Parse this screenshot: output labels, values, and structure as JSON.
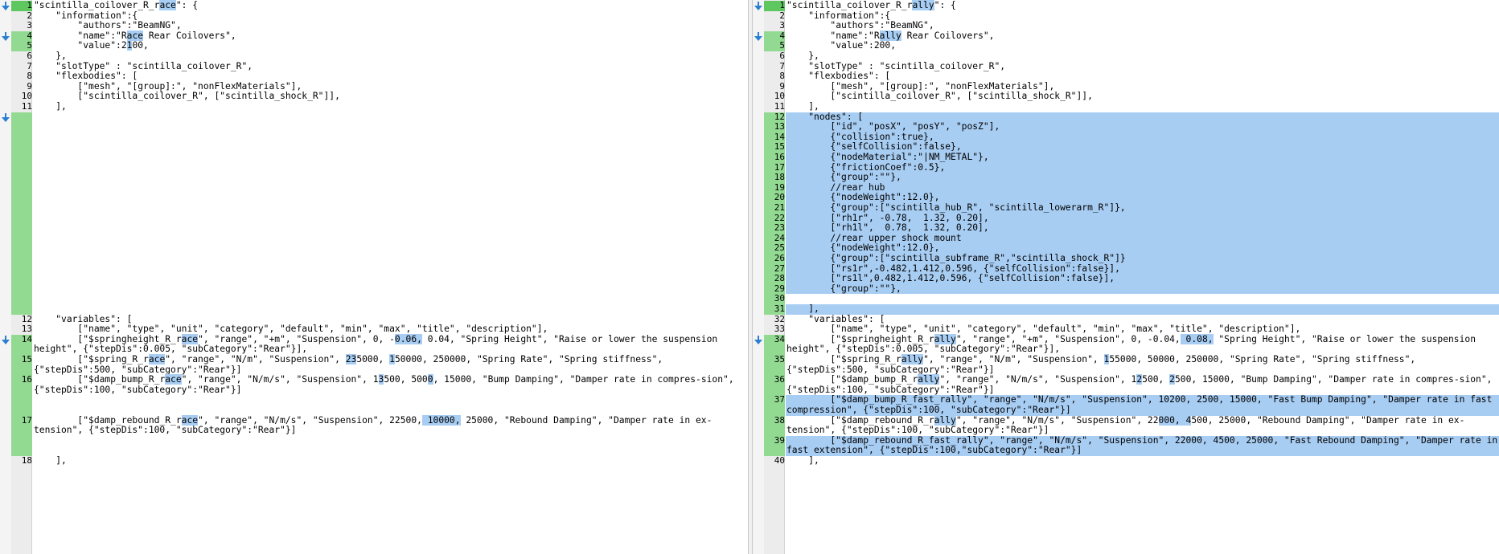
{
  "left": {
    "lines": [
      {
        "n": "1",
        "t": [
          [
            "\"scintilla_coilover_R_r",
            0
          ],
          [
            "ace",
            1
          ],
          [
            "\": {",
            0
          ]
        ]
      },
      {
        "n": "2",
        "t": [
          [
            "    \"information\":{",
            0
          ]
        ]
      },
      {
        "n": "3",
        "t": [
          [
            "        \"authors\":\"BeamNG\",",
            0
          ]
        ]
      },
      {
        "n": "4",
        "t": [
          [
            "        \"name\":\"R",
            0
          ],
          [
            "ace",
            1
          ],
          [
            " Rear Coilovers\",",
            0
          ]
        ]
      },
      {
        "n": "5",
        "t": [
          [
            "        \"value\":2",
            0
          ],
          [
            "1",
            1
          ],
          [
            "00,",
            0
          ]
        ]
      },
      {
        "n": "6",
        "t": [
          [
            "    },",
            0
          ]
        ]
      },
      {
        "n": "7",
        "t": [
          [
            "    \"slotType\" : \"scintilla_coilover_R\",",
            0
          ]
        ]
      },
      {
        "n": "8",
        "t": [
          [
            "    \"flexbodies\": [",
            0
          ]
        ]
      },
      {
        "n": "9",
        "t": [
          [
            "        [\"mesh\", \"[group]:\", \"nonFlexMaterials\"],",
            0
          ]
        ]
      },
      {
        "n": "10",
        "t": [
          [
            "        [\"scintilla_coilover_R\", [\"scintilla_shock_R\"]],",
            0
          ]
        ]
      },
      {
        "n": "11",
        "t": [
          [
            "    ],",
            0
          ]
        ]
      },
      {
        "n": "12",
        "t": [
          [
            "    \"variables\": [",
            0
          ]
        ]
      },
      {
        "n": "13",
        "t": [
          [
            "        [\"name\", \"type\", \"unit\", \"category\", \"default\", \"min\", \"max\", \"title\", \"description\"],",
            0
          ]
        ]
      },
      {
        "n": "14",
        "t": [
          [
            "        [\"$springheight_R_r",
            0
          ],
          [
            "ace",
            1
          ],
          [
            "\", \"range\", \"+m\", \"Suspension\", 0, -",
            0
          ],
          [
            "0.06,",
            1
          ],
          [
            " 0.04, \"Spring Height\", \"Raise or lower the suspension height\", {\"stepDis\":0.005, \"subCategory\":\"Rear\"}],",
            0
          ]
        ]
      },
      {
        "n": "15",
        "t": [
          [
            "        [\"$spring_R_r",
            0
          ],
          [
            "ace",
            1
          ],
          [
            "\", \"range\", \"N/m\", \"Suspension\", ",
            0
          ],
          [
            "23",
            1
          ],
          [
            "5000, ",
            0
          ],
          [
            "1",
            1
          ],
          [
            "50000, 250000, \"Spring Rate\", \"Spring stiffness\", {\"stepDis\":500, \"subCategory\":\"Rear\"}]",
            0
          ]
        ]
      },
      {
        "n": "16",
        "t": [
          [
            "        [\"$damp_bump_R_r",
            0
          ],
          [
            "ace",
            1
          ],
          [
            "\", \"range\", \"N/m/s\", \"Suspension\", 1",
            0
          ],
          [
            "3",
            1
          ],
          [
            "500, 500",
            0
          ],
          [
            "0",
            1
          ],
          [
            ", 15000, \"Bump Damping\", \"Damper rate in compres-sion\", {\"stepDis\":100, \"subCategory\":\"Rear\"}]",
            0
          ]
        ]
      },
      {
        "n": "17",
        "t": [
          [
            "        [\"$damp_rebound_R_r",
            0
          ],
          [
            "ace",
            1
          ],
          [
            "\", \"range\", \"N/m/s\", \"Suspension\", 22500,",
            0
          ],
          [
            " 10000,",
            1
          ],
          [
            " 25000, \"Rebound Damping\", \"Damper rate in ex-tension\", {\"stepDis\":100, \"subCategory\":\"Rear\"}]",
            0
          ]
        ]
      },
      {
        "n": "18",
        "t": [
          [
            "    ],",
            0
          ]
        ]
      }
    ]
  },
  "right": {
    "lines": [
      {
        "n": "1",
        "t": [
          [
            "\"scintilla_coilover_R_r",
            0
          ],
          [
            "ally",
            1
          ],
          [
            "\": {",
            0
          ]
        ]
      },
      {
        "n": "2",
        "t": [
          [
            "    \"information\":{",
            0
          ]
        ]
      },
      {
        "n": "3",
        "t": [
          [
            "        \"authors\":\"BeamNG\",",
            0
          ]
        ]
      },
      {
        "n": "4",
        "t": [
          [
            "        \"name\":\"R",
            0
          ],
          [
            "ally",
            1
          ],
          [
            " Rear Coilovers\",",
            0
          ]
        ]
      },
      {
        "n": "5",
        "t": [
          [
            "        \"value\":200,",
            0
          ]
        ]
      },
      {
        "n": "6",
        "t": [
          [
            "    },",
            0
          ]
        ]
      },
      {
        "n": "7",
        "t": [
          [
            "    \"slotType\" : \"scintilla_coilover_R\",",
            0
          ]
        ]
      },
      {
        "n": "8",
        "t": [
          [
            "    \"flexbodies\": [",
            0
          ]
        ]
      },
      {
        "n": "9",
        "t": [
          [
            "        [\"mesh\", \"[group]:\", \"nonFlexMaterials\"],",
            0
          ]
        ]
      },
      {
        "n": "10",
        "t": [
          [
            "        [\"scintilla_coilover_R\", [\"scintilla_shock_R\"]],",
            0
          ]
        ]
      },
      {
        "n": "11",
        "t": [
          [
            "    ],",
            0
          ]
        ]
      },
      {
        "n": "12",
        "t": [
          [
            "    \"nodes\": [",
            1
          ]
        ]
      },
      {
        "n": "13",
        "t": [
          [
            "        [\"id\", \"posX\", \"posY\", \"posZ\"],",
            1
          ]
        ]
      },
      {
        "n": "14",
        "t": [
          [
            "        {\"collision\":true},",
            1
          ]
        ]
      },
      {
        "n": "15",
        "t": [
          [
            "        {\"selfCollision\":false},",
            1
          ]
        ]
      },
      {
        "n": "16",
        "t": [
          [
            "        {\"nodeMaterial\":\"|NM_METAL\"},",
            1
          ]
        ]
      },
      {
        "n": "17",
        "t": [
          [
            "        {\"frictionCoef\":0.5},",
            1
          ]
        ]
      },
      {
        "n": "18",
        "t": [
          [
            "        {\"group\":\"\"},",
            1
          ]
        ]
      },
      {
        "n": "19",
        "t": [
          [
            "        //rear hub",
            1
          ]
        ]
      },
      {
        "n": "20",
        "t": [
          [
            "        {\"nodeWeight\":12.0},",
            1
          ]
        ]
      },
      {
        "n": "21",
        "t": [
          [
            "        {\"group\":[\"scintilla_hub_R\", \"scintilla_lowerarm_R\"]},",
            1
          ]
        ]
      },
      {
        "n": "22",
        "t": [
          [
            "        [\"rh1r\", -0.78,  1.32, 0.20],",
            1
          ]
        ]
      },
      {
        "n": "23",
        "t": [
          [
            "        [\"rh1l\",  0.78,  1.32, 0.20],",
            1
          ]
        ]
      },
      {
        "n": "24",
        "t": [
          [
            "        //rear upper shock mount",
            1
          ]
        ]
      },
      {
        "n": "25",
        "t": [
          [
            "        {\"nodeWeight\":12.0},",
            1
          ]
        ]
      },
      {
        "n": "26",
        "t": [
          [
            "        {\"group\":[\"scintilla_subframe_R\",\"scintilla_shock_R\"]}",
            1
          ]
        ]
      },
      {
        "n": "27",
        "t": [
          [
            "        [\"rs1r\",-0.482,1.412,0.596, {\"selfCollision\":false}],",
            1
          ]
        ]
      },
      {
        "n": "28",
        "t": [
          [
            "        [\"rs1l\",0.482,1.412,0.596, {\"selfCollision\":false}],",
            1
          ]
        ]
      },
      {
        "n": "29",
        "t": [
          [
            "        {\"group\":\"\"},",
            1
          ]
        ]
      },
      {
        "n": "30",
        "t": [
          [
            "",
            0
          ]
        ]
      },
      {
        "n": "31",
        "t": [
          [
            "    ],",
            1
          ]
        ]
      },
      {
        "n": "32",
        "t": [
          [
            "    \"variables\": [",
            0
          ]
        ]
      },
      {
        "n": "33",
        "t": [
          [
            "        [\"name\", \"type\", \"unit\", \"category\", \"default\", \"min\", \"max\", \"title\", \"description\"],",
            0
          ]
        ]
      },
      {
        "n": "34",
        "t": [
          [
            "        [\"$springheight_R_r",
            0
          ],
          [
            "ally",
            1
          ],
          [
            "\", \"range\", \"+m\", \"Suspension\", 0, -0.04,",
            0
          ],
          [
            " 0.08,",
            1
          ],
          [
            " \"Spring Height\", \"Raise or lower the suspension height\", {\"stepDis\":0.005, \"subCategory\":\"Rear\"}],",
            0
          ]
        ]
      },
      {
        "n": "35",
        "t": [
          [
            "        [\"$spring_R_r",
            0
          ],
          [
            "ally",
            1
          ],
          [
            "\", \"range\", \"N/m\", \"Suspension\", ",
            0
          ],
          [
            "1",
            1
          ],
          [
            "55000, 50000, 250000, \"Spring Rate\", \"Spring stiffness\", {\"stepDis\":500, \"subCategory\":\"Rear\"}]",
            0
          ]
        ]
      },
      {
        "n": "36",
        "t": [
          [
            "        [\"$damp_bump_R_r",
            0
          ],
          [
            "ally",
            1
          ],
          [
            "\", \"range\", \"N/m/s\", \"Suspension\", 1",
            0
          ],
          [
            "2",
            1
          ],
          [
            "500, ",
            0
          ],
          [
            "2",
            1
          ],
          [
            "500, 15000, \"Bump Damping\", \"Damper rate in compres-sion\", {\"stepDis\":100, \"subCategory\":\"Rear\"}]",
            0
          ]
        ]
      },
      {
        "n": "37",
        "t": [
          [
            "        [\"$damp_bump_R_fast_rally\", \"range\", \"N/m/s\", \"Suspension\", 10200, 2500, 15000, \"Fast Bump Damping\", \"Damper rate in fast compression\", {\"stepDis\":100, \"subCategory\":\"Rear\"}]",
            1
          ]
        ]
      },
      {
        "n": "38",
        "t": [
          [
            "        [\"$damp_rebound_R_r",
            0
          ],
          [
            "ally",
            1
          ],
          [
            "\", \"range\", \"N/m/s\", \"Suspension\", 22",
            0
          ],
          [
            "000, 4",
            1
          ],
          [
            "500, 25000, \"Rebound Damping\", \"Damper rate in ex-tension\", {\"stepDis\":100, \"subCategory\":\"Rear\"}]",
            0
          ]
        ]
      },
      {
        "n": "39",
        "t": [
          [
            "        [\"$damp_rebound_R_fast_rally\", \"range\", \"N/m/s\", \"Suspension\", 22000, 4500, 25000, \"Fast Rebound Damping\", \"Damper rate in fast extension\", {\"stepDis\":100,\"subCategory\":\"Rear\"}]",
            1
          ]
        ]
      },
      {
        "n": "40",
        "t": [
          [
            "    ],",
            0
          ]
        ]
      }
    ]
  }
}
